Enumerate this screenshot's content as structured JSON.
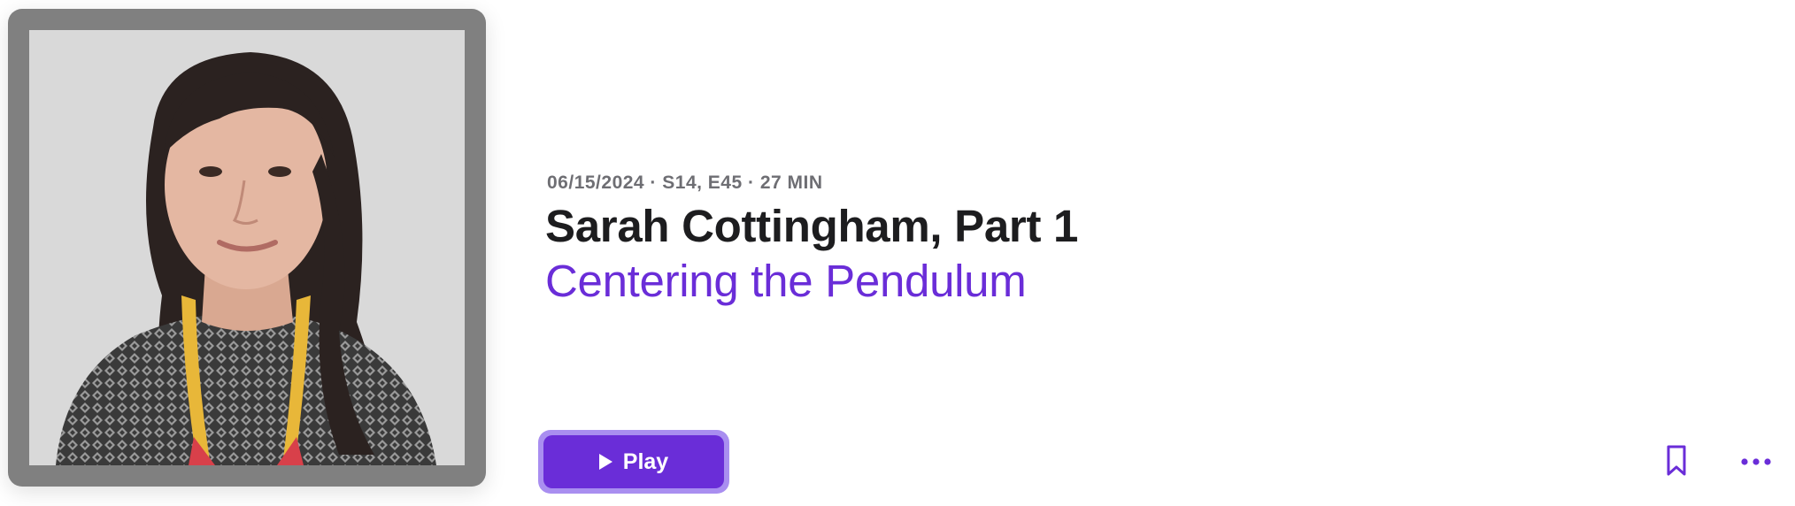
{
  "episode": {
    "meta": "06/15/2024 · S14, E45 · 27 MIN",
    "title": "Sarah Cottingham, Part 1",
    "subtitle": "Centering the Pendulum"
  },
  "actions": {
    "play_label": "Play",
    "play_icon": "play-icon",
    "bookmark_icon": "bookmark-icon",
    "more_icon": "more-icon"
  },
  "colors": {
    "accent": "#6a2dd8",
    "accent_ring": "#a98ef0",
    "title": "#1d1d1f",
    "meta": "#6e6e73",
    "artwork_frame": "#808080"
  }
}
